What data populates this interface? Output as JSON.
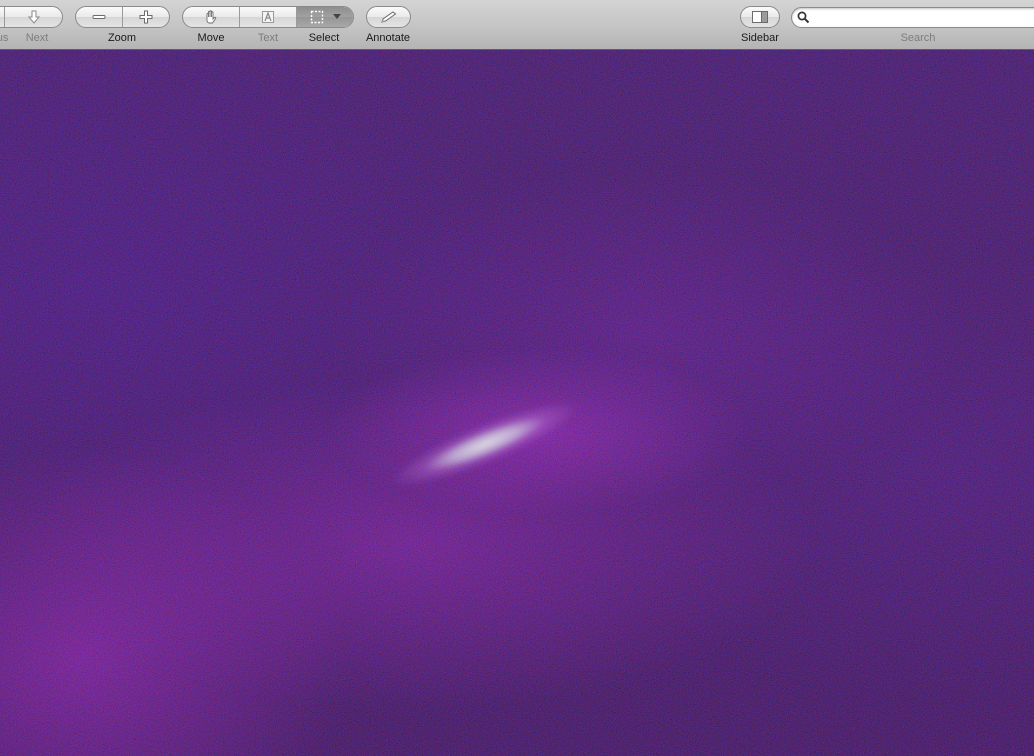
{
  "toolbar": {
    "previous_label": "Previous",
    "next_label": "Next",
    "zoom_label": "Zoom",
    "move_label": "Move",
    "text_label": "Text",
    "select_label": "Select",
    "annotate_label": "Annotate",
    "sidebar_label": "Sidebar",
    "search_label": "Search"
  },
  "search": {
    "value": "",
    "placeholder": ""
  },
  "icons": {
    "previous": "arrow-up-icon",
    "next": "arrow-down-icon",
    "zoom_out": "minus-icon",
    "zoom_in": "plus-icon",
    "move": "hand-icon",
    "text": "text-cursor-icon",
    "select": "marquee-select-icon",
    "select_menu": "dropdown-triangle-icon",
    "annotate": "pencil-icon",
    "sidebar": "sidebar-icon",
    "search": "magnifier-icon"
  },
  "colors": {
    "toolbar_bg": "#c4c4c4",
    "image_bg": "#1a1238",
    "image_glow": "#b02cc8",
    "streak": "#e1e1e6"
  }
}
